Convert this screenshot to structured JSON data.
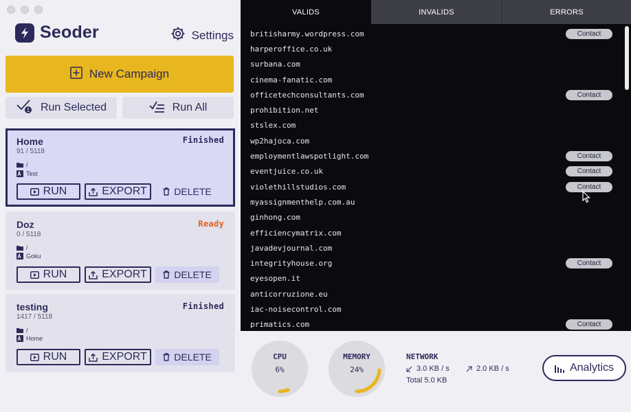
{
  "app": {
    "name": "Seoder"
  },
  "header": {
    "settings_label": "Settings"
  },
  "toolbar": {
    "new_campaign_label": "New Campaign",
    "run_selected_label": "Run Selected",
    "run_all_label": "Run All"
  },
  "campaigns": [
    {
      "name": "Home",
      "progress": "91 / 5118",
      "status": "Finished",
      "folder": "/",
      "keyword": "Test",
      "selected": true
    },
    {
      "name": "Doz",
      "progress": "0 / 5118",
      "status": "Ready",
      "folder": "/",
      "keyword": "Goku",
      "selected": false
    },
    {
      "name": "testing",
      "progress": "1417 / 5118",
      "status": "Finished",
      "folder": "/",
      "keyword": "Home",
      "selected": false
    }
  ],
  "card_actions": {
    "run": "RUN",
    "export": "EXPORT",
    "delete": "DELETE"
  },
  "tabs": [
    {
      "label": "VALIDS",
      "active": true
    },
    {
      "label": "INVALIDS",
      "active": false
    },
    {
      "label": "ERRORS",
      "active": false
    }
  ],
  "contact_label": "Contact",
  "domains": [
    {
      "name": "britisharmy.wordpress.com",
      "contact": true
    },
    {
      "name": "harperoffice.co.uk",
      "contact": false
    },
    {
      "name": "surbana.com",
      "contact": false
    },
    {
      "name": "cinema-fanatic.com",
      "contact": false
    },
    {
      "name": "officetechconsultants.com",
      "contact": true
    },
    {
      "name": "prohibition.net",
      "contact": false
    },
    {
      "name": "stslex.com",
      "contact": false
    },
    {
      "name": "wp2hajoca.com",
      "contact": false
    },
    {
      "name": "employmentlawspotlight.com",
      "contact": true
    },
    {
      "name": "eventjuice.co.uk",
      "contact": true
    },
    {
      "name": "violethillstudios.com",
      "contact": true
    },
    {
      "name": "myassignmenthelp.com.au",
      "contact": false
    },
    {
      "name": "ginhong.com",
      "contact": false
    },
    {
      "name": "efficiencymatrix.com",
      "contact": false
    },
    {
      "name": "javadevjournal.com",
      "contact": false
    },
    {
      "name": "integrityhouse.org",
      "contact": true
    },
    {
      "name": "eyesopen.it",
      "contact": false
    },
    {
      "name": "anticorruzione.eu",
      "contact": false
    },
    {
      "name": "iac-noisecontrol.com",
      "contact": false
    },
    {
      "name": "primatics.com",
      "contact": true
    }
  ],
  "stats": {
    "cpu": {
      "label": "CPU",
      "value": "6%",
      "fraction": 0.06
    },
    "memory": {
      "label": "MEMORY",
      "value": "24%",
      "fraction": 0.24
    },
    "network": {
      "label": "NETWORK",
      "down": "3.0 KB / s",
      "up": "2.0 KB / s",
      "total": "Total  5.0 KB"
    }
  },
  "analytics_label": "Analytics",
  "colors": {
    "accent": "#e8b71f",
    "brand": "#2c2a5a",
    "ready": "#d9631e",
    "panel": "#0a0a0f"
  }
}
